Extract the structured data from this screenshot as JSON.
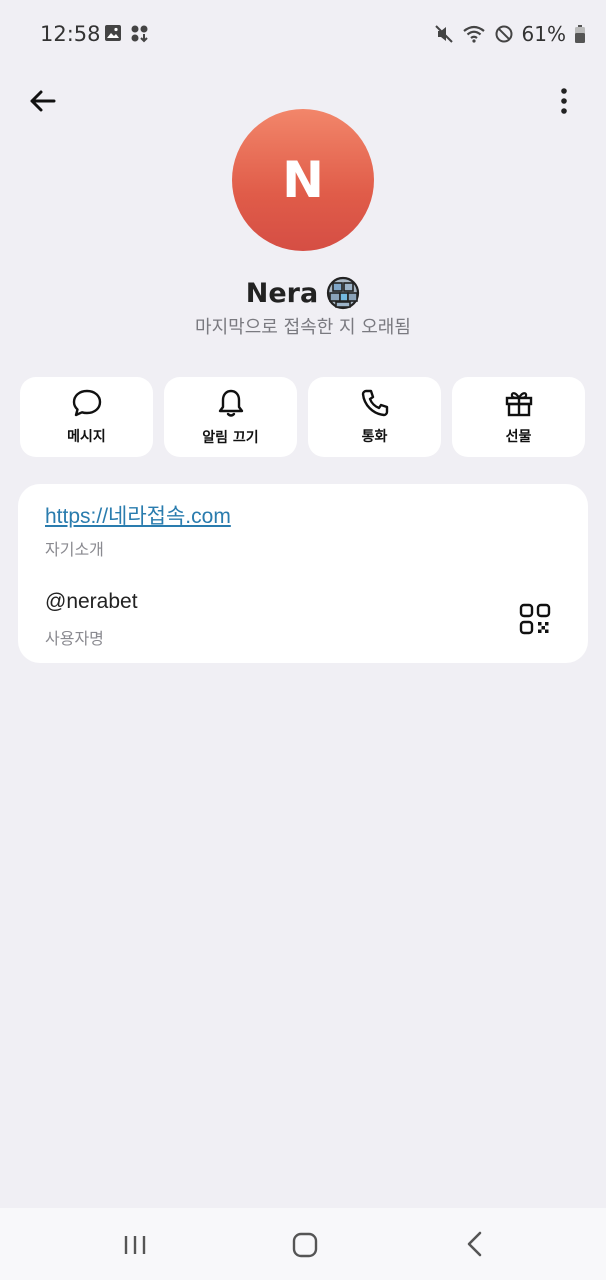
{
  "status_bar": {
    "time": "12:58",
    "battery": "61%",
    "left_icons": [
      "image-icon",
      "apps-download-icon"
    ],
    "right_icons": [
      "mute-icon",
      "wifi-icon",
      "do-not-disturb-icon",
      "battery-icon"
    ]
  },
  "top_bar": {
    "back_icon": "arrow-left-icon",
    "more_icon": "more-vertical-icon"
  },
  "profile": {
    "avatar_letter": "N",
    "name": "Nera",
    "badge_icon": "globe-emoji-icon",
    "status": "마지막으로 접속한 지 오래됨",
    "avatar_colors": [
      "#f2866a",
      "#d54e44"
    ]
  },
  "actions": [
    {
      "label": "메시지",
      "icon": "message-icon"
    },
    {
      "label": "알림 끄기",
      "icon": "bell-icon"
    },
    {
      "label": "통화",
      "icon": "phone-icon"
    },
    {
      "label": "선물",
      "icon": "gift-icon"
    }
  ],
  "info": {
    "bio": "https://네라접속.com",
    "bio_caption": "자기소개",
    "username": "@nerabet",
    "username_caption": "사용자명",
    "qr_icon": "qr-code-icon",
    "link_color": "#2a7cae"
  },
  "nav_bar": {
    "icons": [
      "recent-apps-icon",
      "home-icon",
      "back-icon"
    ]
  }
}
